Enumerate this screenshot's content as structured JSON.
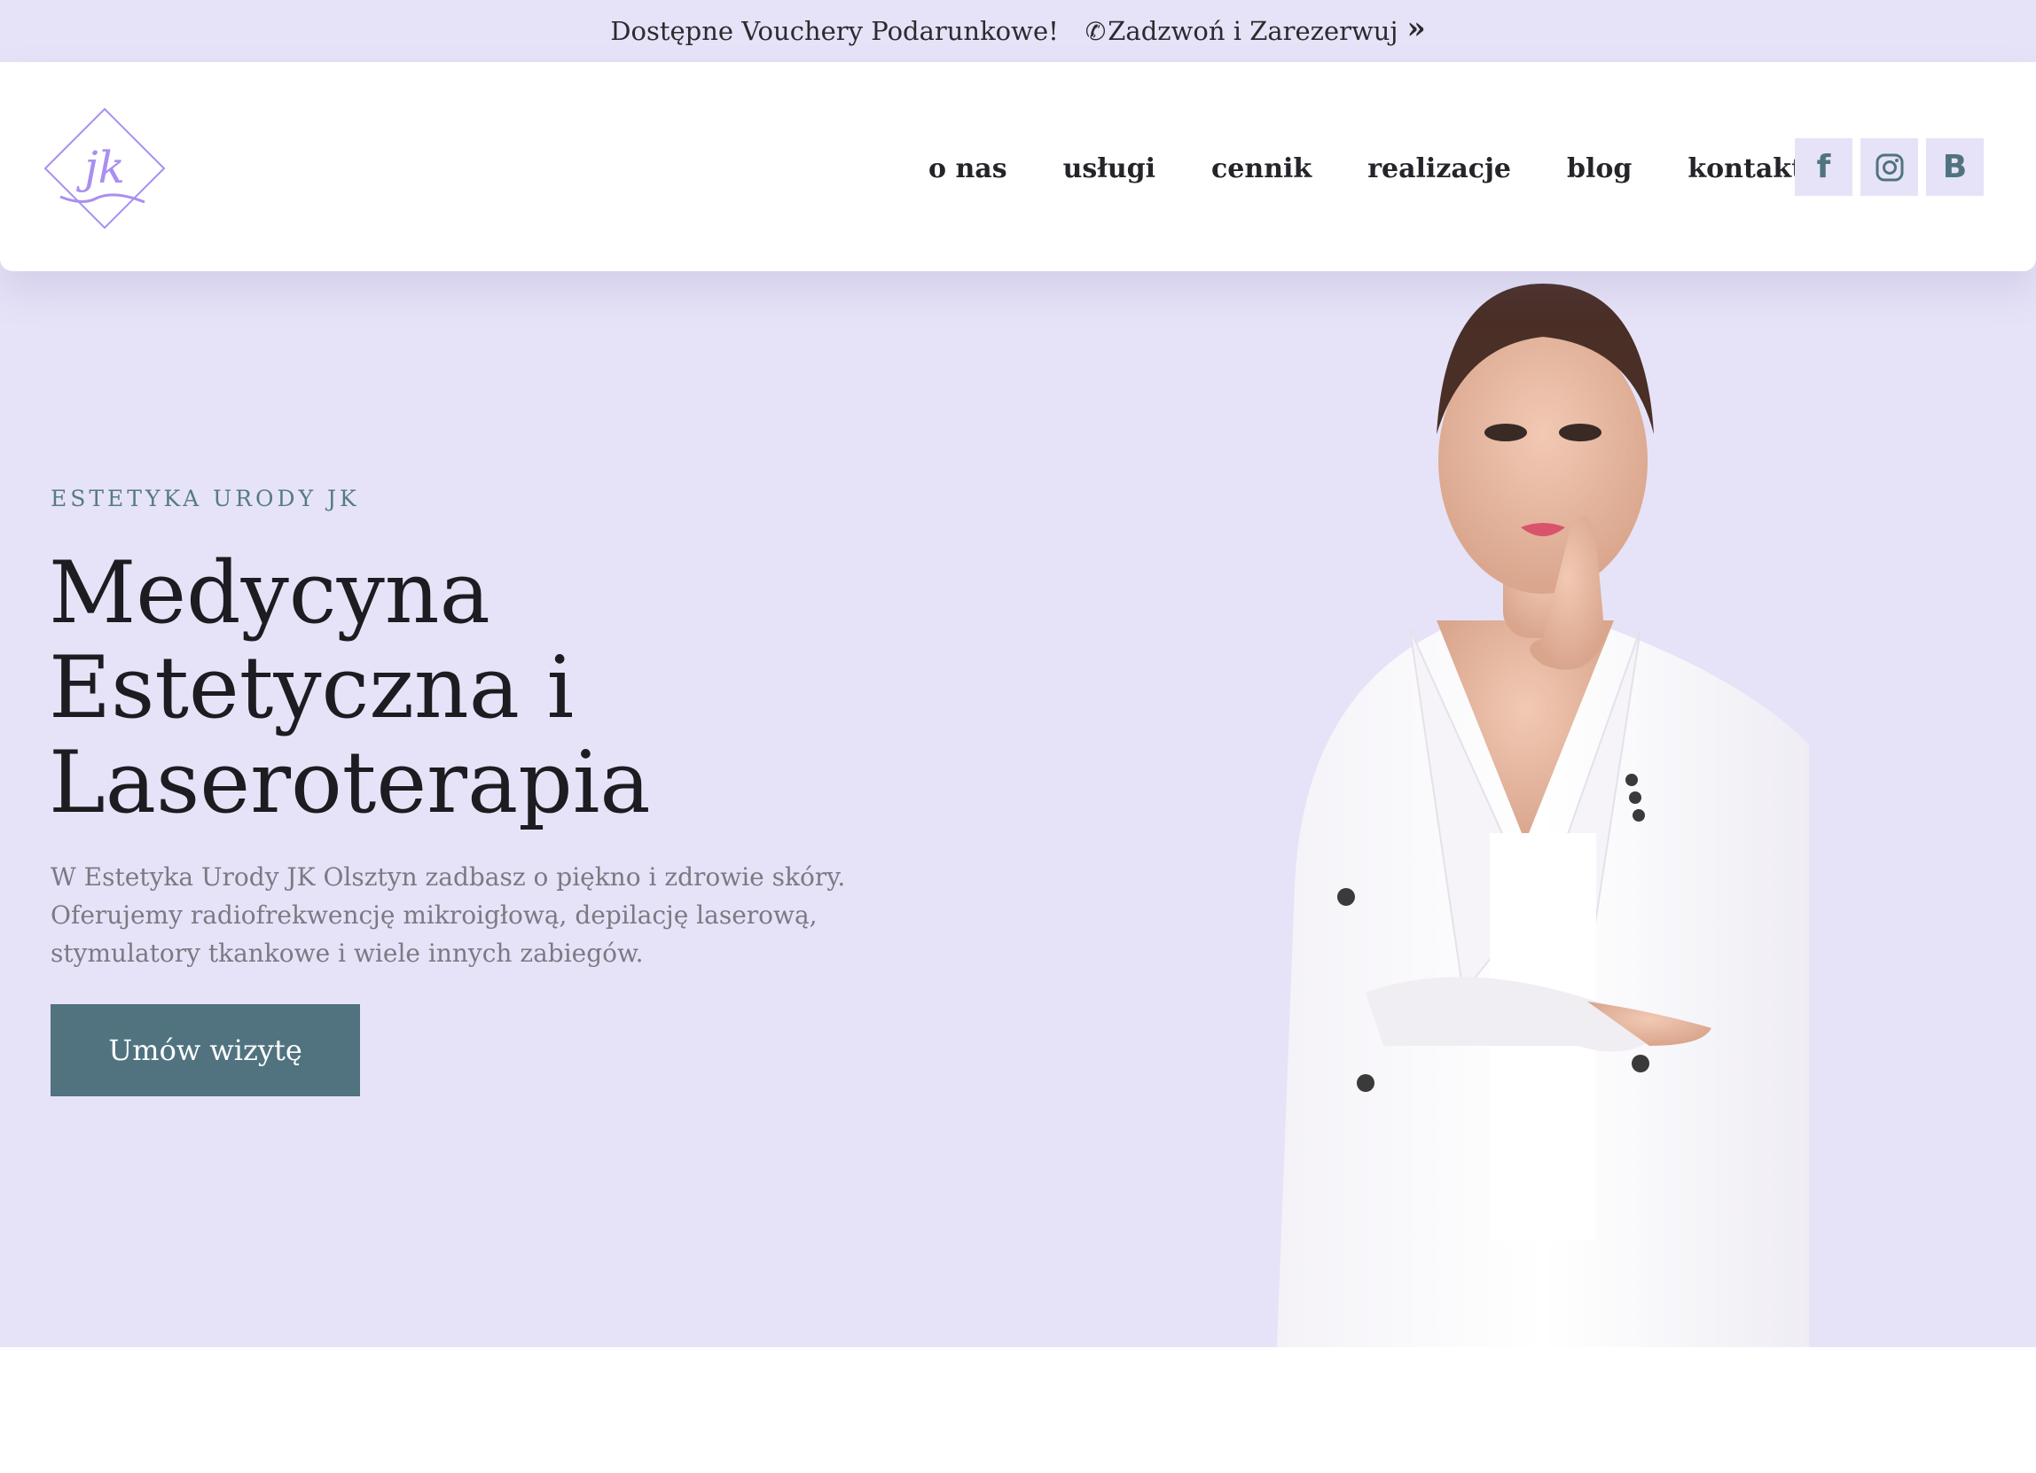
{
  "topbar": {
    "promo": "Dostępne Vouchery Podarunkowe!",
    "call_text": "Zadzwoń i Zarezerwuj",
    "phone_icon": "phone-icon",
    "arrow_icon": "double-chevron-right-icon"
  },
  "logo": {
    "text": "jk"
  },
  "nav": {
    "items": [
      "o nas",
      "usługi",
      "cennik",
      "realizacje",
      "blog",
      "kontakt"
    ]
  },
  "social": {
    "items": [
      {
        "icon": "facebook-icon",
        "glyph": "f"
      },
      {
        "icon": "instagram-icon",
        "glyph": ""
      },
      {
        "icon": "booksy-icon",
        "glyph": "B"
      }
    ]
  },
  "hero": {
    "eyebrow": "ESTETYKA URODY JK",
    "headline_lines": [
      "Medycyna",
      "Estetyczna i",
      "Laseroterapia"
    ],
    "description_lines": [
      "W Estetyka Urody JK Olsztyn zadbasz o piękno i zdrowie skóry.",
      "Oferujemy radiofrekwencję mikroigłową, depilację laserową,",
      "stymulatory tkankowe i wiele innych zabiegów."
    ],
    "cta_label": "Umów wizytę"
  },
  "colors": {
    "lavender_bg": "#e6e3f8",
    "accent_teal": "#517380",
    "logo_purple": "#a98ff0"
  }
}
